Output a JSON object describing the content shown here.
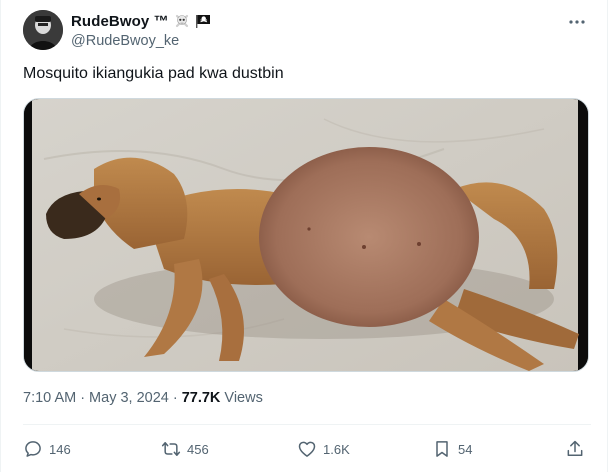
{
  "author": {
    "display_name": "RudeBwoy ™",
    "handle": "@RudeBwoy_ke",
    "emojis": [
      "skull-crossbones-icon",
      "pirate-flag-icon"
    ]
  },
  "tweet": {
    "text": "Mosquito ikiangukia pad kwa dustbin",
    "time": "7:10 AM",
    "date": "May 3, 2024",
    "separator": "·",
    "views_count": "77.7K",
    "views_label": "Views"
  },
  "actions": {
    "replies": "146",
    "reposts": "456",
    "likes": "1.6K",
    "bookmarks": "54"
  },
  "colors": {
    "text_primary": "#0f1419",
    "text_secondary": "#536471",
    "border": "#eff3f4"
  }
}
